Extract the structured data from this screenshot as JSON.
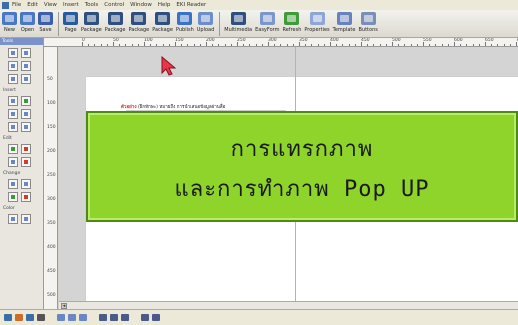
{
  "menubar": {
    "items": [
      "File",
      "Edit",
      "View",
      "Insert",
      "Tools",
      "Control",
      "Window",
      "Help",
      "EKI Reader"
    ]
  },
  "toolbar": {
    "buttons": [
      {
        "label": "New",
        "icon": "new-file-icon",
        "color": "#4a78c2"
      },
      {
        "label": "Open",
        "icon": "open-folder-icon",
        "color": "#4a78c2"
      },
      {
        "label": "Save",
        "icon": "save-icon",
        "color": "#3b5fa8"
      },
      {
        "label": "Page",
        "icon": "page-icon",
        "color": "#2a5a9e"
      },
      {
        "label": "Package",
        "icon": "package-icon",
        "color": "#2f4f7f"
      },
      {
        "label": "Package",
        "icon": "package-icon",
        "color": "#2f4f7f"
      },
      {
        "label": "Package",
        "icon": "package-icon",
        "color": "#2f4f7f"
      },
      {
        "label": "Package",
        "icon": "package-icon",
        "color": "#2f4f7f"
      },
      {
        "label": "Publish",
        "icon": "publish-icon",
        "color": "#3a72c8"
      },
      {
        "label": "Upload",
        "icon": "upload-icon",
        "color": "#6c8fca"
      },
      {
        "label": "Multimedia",
        "icon": "multimedia-icon",
        "color": "#2f4f7f"
      },
      {
        "label": "EasyForm",
        "icon": "easyform-icon",
        "color": "#7b96c9"
      },
      {
        "label": "Refresh",
        "icon": "refresh-icon",
        "color": "#3f9a3a"
      },
      {
        "label": "Properties",
        "icon": "properties-icon",
        "color": "#8ea6d3"
      },
      {
        "label": "Template",
        "icon": "template-icon",
        "color": "#6782bd"
      },
      {
        "label": "Buttons",
        "icon": "buttons-icon",
        "color": "#7a8fb8"
      }
    ]
  },
  "leftpanel": {
    "header": "Tools",
    "sections": [
      "Insert",
      "Edit",
      "Change",
      "Color"
    ]
  },
  "ruler": {
    "top_numbers": [
      "0",
      "50",
      "100",
      "150",
      "200",
      "250",
      "300",
      "350",
      "400",
      "450",
      "500",
      "550",
      "600",
      "650",
      "700"
    ],
    "left_numbers": [
      "50",
      "100",
      "150",
      "200",
      "250",
      "300",
      "350",
      "400",
      "450",
      "500"
    ]
  },
  "page": {
    "heading_red": "ตัวอย่าง",
    "heading_text": "(ฝึกทักษะ) หมายถึง การนำเสนอข้อมูลผ่านสื่อ"
  },
  "banner": {
    "line1": "การแทรกภาพ",
    "line2": "และการทำภาพ Pop UP",
    "bg_color": "#8fd42a"
  },
  "colors": {
    "cursor": "#e8364a",
    "panel_header": "#7b91c9"
  }
}
